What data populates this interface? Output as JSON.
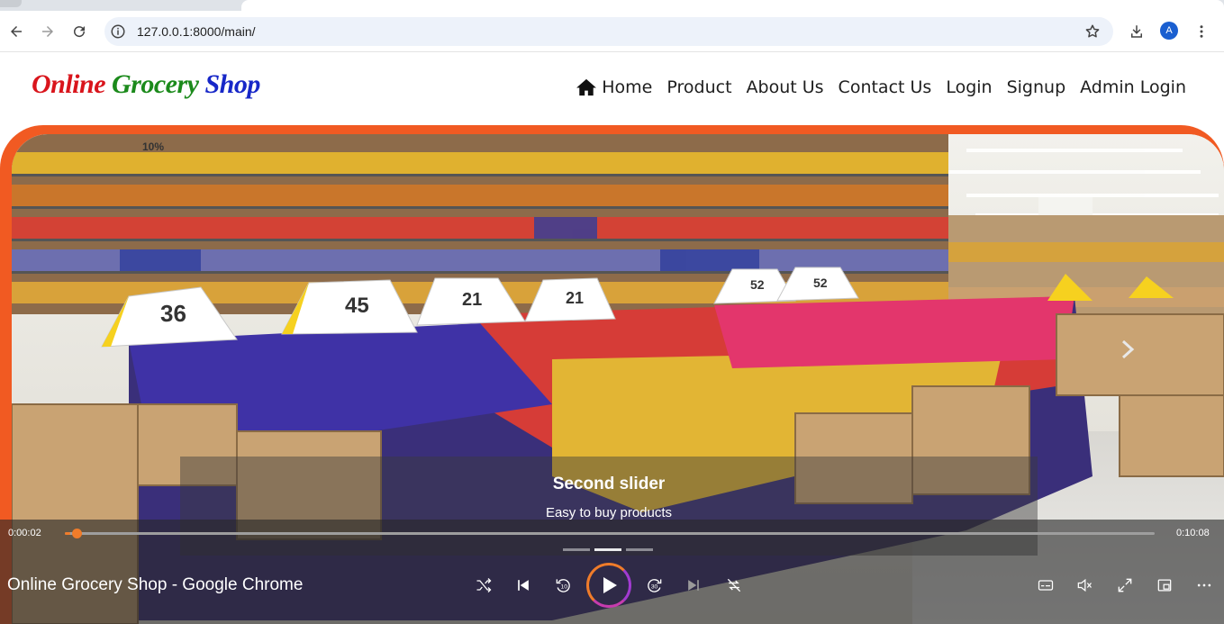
{
  "browser": {
    "url": "127.0.0.1:8000/main/",
    "avatar_letter": "A",
    "icons": [
      "back-icon",
      "forward-icon",
      "reload-icon",
      "site-info-icon",
      "bookmark-star-icon",
      "download-icon",
      "menu-dots-icon"
    ]
  },
  "site": {
    "logo_word1": "Online",
    "logo_word2": "Grocery",
    "logo_word3": "Shop",
    "nav": {
      "home": "Home",
      "product": "Product",
      "about": "About Us",
      "contact": "Contact Us",
      "login": "Login",
      "signup": "Signup",
      "admin": "Admin Login"
    },
    "slider": {
      "title": "Second slider",
      "subtitle": "Easy to buy products",
      "slide_count": 3,
      "active_index": 1
    },
    "colors": {
      "logo_red": "#d9151c",
      "logo_green": "#1b8a1b",
      "logo_blue": "#1727c8",
      "hero_border": "#f15a22"
    }
  },
  "player": {
    "current_time": "0:00:02",
    "total_time": "0:10:08",
    "progress": 0.0033,
    "window_title": "Online Grocery Shop - Google Chrome",
    "accent": "#f07c2a"
  }
}
